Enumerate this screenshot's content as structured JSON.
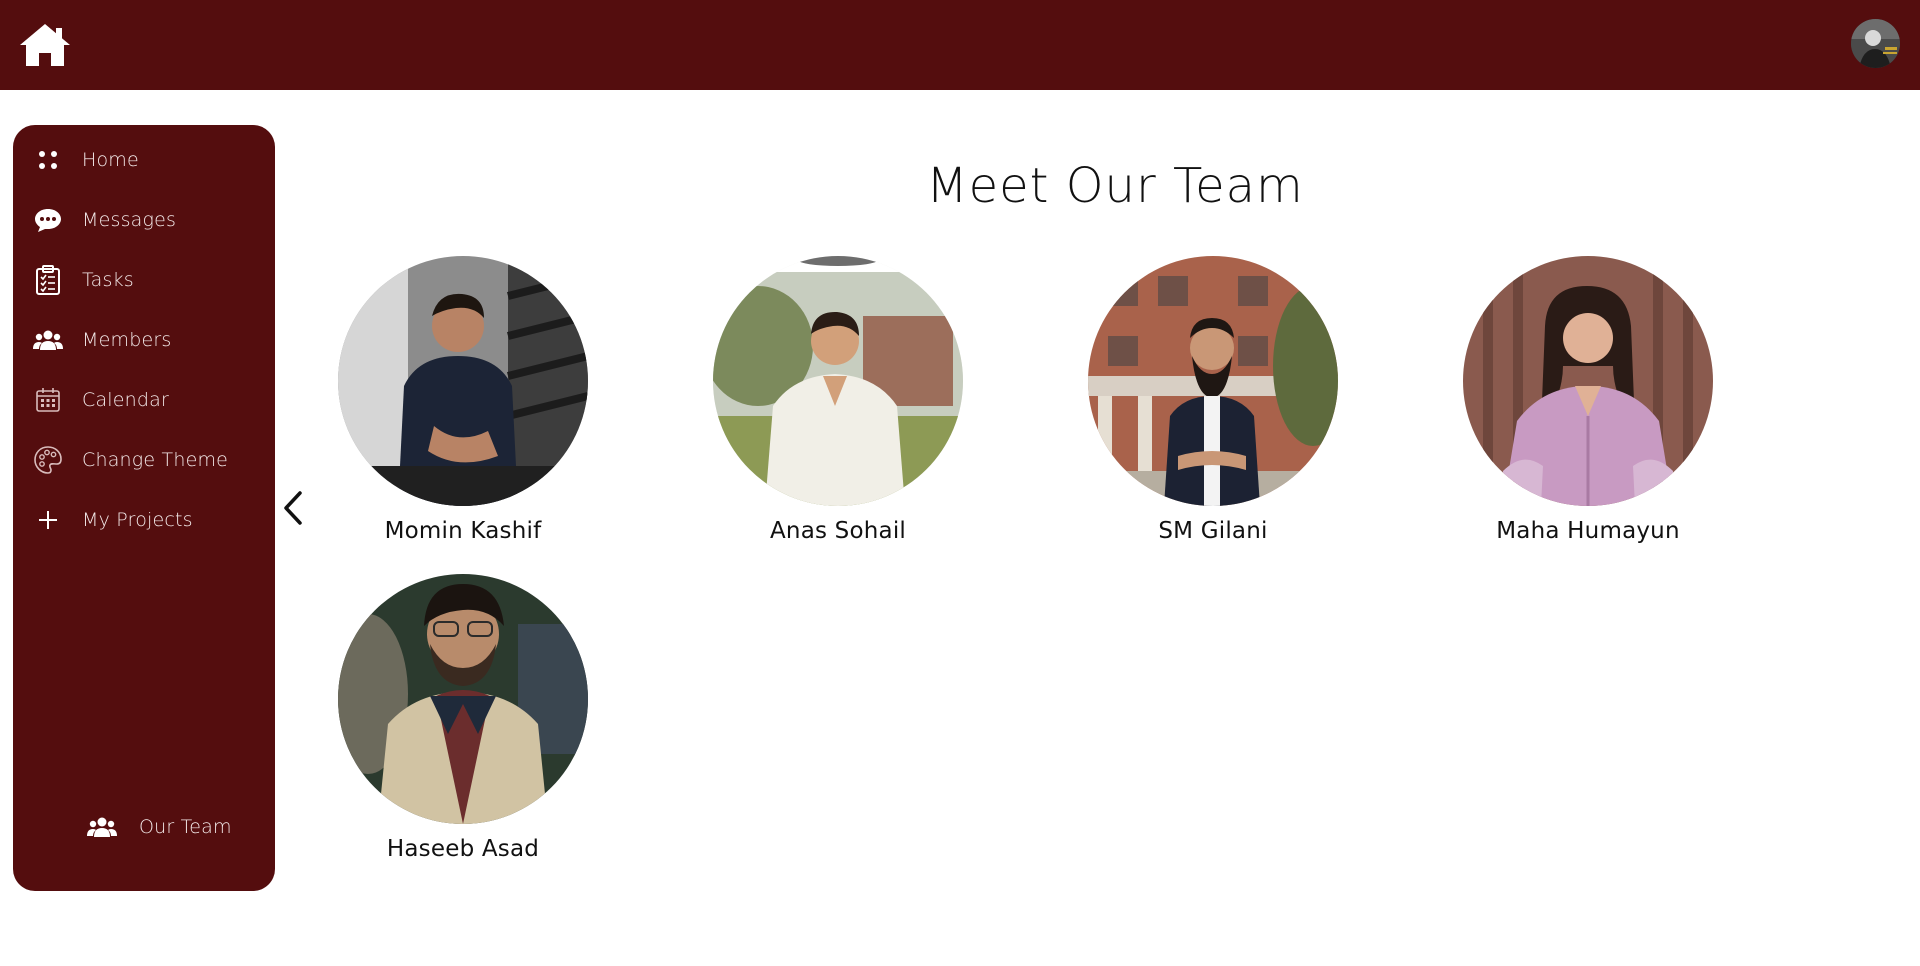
{
  "header": {
    "home_icon": "home-icon",
    "avatar_icon": "user-avatar"
  },
  "sidebar": {
    "items": [
      {
        "label": "Home",
        "icon": "dots-grid-icon"
      },
      {
        "label": "Messages",
        "icon": "chat-bubble-icon"
      },
      {
        "label": "Tasks",
        "icon": "clipboard-list-icon"
      },
      {
        "label": "Members",
        "icon": "users-icon"
      },
      {
        "label": "Calendar",
        "icon": "calendar-icon"
      },
      {
        "label": "Change Theme",
        "icon": "palette-icon"
      },
      {
        "label": "My Projects",
        "icon": "plus-icon"
      }
    ],
    "team": {
      "label": "Our Team",
      "icon": "users-icon"
    },
    "collapse_icon": "chevron-left-icon"
  },
  "main": {
    "title": "Meet Our Team",
    "members": [
      {
        "name": "Momin Kashif"
      },
      {
        "name": "Anas Sohail"
      },
      {
        "name": "SM Gilani"
      },
      {
        "name": "Maha Humayun"
      },
      {
        "name": "Haseeb Asad"
      }
    ]
  },
  "colors": {
    "brand": "#540d0e",
    "sidebar_text": "#f3e9e9",
    "background": "#ffffff"
  }
}
